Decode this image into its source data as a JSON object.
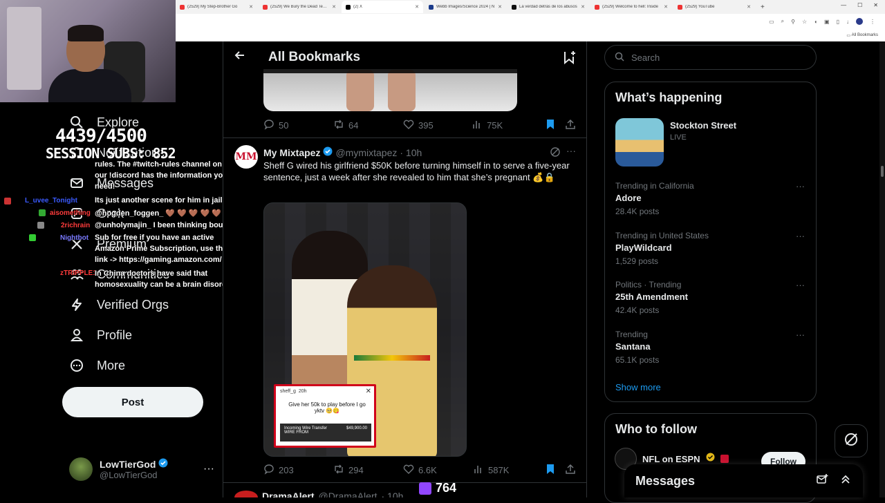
{
  "browser": {
    "tabs": [
      {
        "label": "(2529) My Step-Brother Go",
        "color": "#e33"
      },
      {
        "label": "(2529) We Bury the Dead Teaser",
        "color": "#e33"
      },
      {
        "label": "(2) X",
        "color": "#000"
      },
      {
        "label": "Webb Images/Science 2024 | N",
        "color": "#1a3a8a"
      },
      {
        "label": "La verdad detrás de los abusos",
        "color": "#111"
      },
      {
        "label": "(2529) Welcome to hell: Inside",
        "color": "#e33"
      },
      {
        "label": "(2529) YouTube",
        "color": "#e33"
      }
    ],
    "new_tab": "+",
    "all_bookmarks": "All Bookmarks"
  },
  "overlay": {
    "sub_goal": "4439/4500",
    "session_subs": "SESSION SUBS: 852"
  },
  "nav": {
    "explore": "Explore",
    "notifications": "Notifications",
    "messages": "Messages",
    "grok": "Grok",
    "premium": "Premium",
    "communities": "Communities",
    "verified_orgs": "Verified Orgs",
    "profile": "Profile",
    "more": "More",
    "post": "Post"
  },
  "account": {
    "name": "LowTierGod",
    "handle": "@LowTierGod",
    "more": "···"
  },
  "chat": {
    "lines": [
      {
        "text": "rules. The #twitch-rules channel on"
      },
      {
        "text": "our !discord has the information you"
      },
      {
        "text": "need!"
      },
      {
        "text": "Its just another scene for him in jail"
      },
      {
        "text": "@hogden_foggen_ 🤎 🤎 🤎 🤎 🤎"
      },
      {
        "text": "@unholymajin_ I been thinking bout it"
      },
      {
        "text": "Sub for free if you have an active"
      },
      {
        "text": "Amazon Prime Subscription, use this"
      },
      {
        "text": "link -> https://gaming.amazon.com/"
      },
      {
        "text": "In China doctors have said that"
      },
      {
        "text": "homosexuality can be a brain disorder"
      }
    ],
    "users": [
      {
        "name": "L_uvee_Tonight",
        "color": "#3b5bff"
      },
      {
        "name": "aisomething",
        "color": "#ff3b3b"
      },
      {
        "name": "2richrain",
        "color": "#ff3b3b"
      },
      {
        "name": "Nightbot",
        "color": "#7a7aff"
      },
      {
        "name": "zTRIPPLE1",
        "color": "#ff3b3b"
      }
    ]
  },
  "main": {
    "header_title": "All Bookmarks",
    "top_tweet_stats": {
      "replies": "50",
      "retweets": "64",
      "likes": "395",
      "views": "75K"
    },
    "tweet": {
      "name": "My Mixtapez",
      "handle": "@mymixtapez",
      "time": "· 10h",
      "avatar_text": "MM",
      "text": "Sheff G wired his girlfriend $50K before turning himself in to serve a five-year sentence, just a week after she revealed to him that she’s pregnant 💰🔒",
      "inset": {
        "user": "sheff_g",
        "time": "20h",
        "caption": "Give her 50k to play before I go yktv 🥺😋",
        "wire_label": "Incoming Wire Transfer",
        "wire_from": "WIRE FROM",
        "wire_amount": "$49,900.00",
        "close": "✕"
      },
      "stats": {
        "replies": "203",
        "retweets": "294",
        "likes": "6.6K",
        "views": "587K"
      }
    },
    "next_tweet": {
      "name": "DramaAlert",
      "handle": "@DramaAlert",
      "time": "· 10h"
    },
    "live_viewers": "764"
  },
  "right": {
    "search_placeholder": "Search",
    "happening_title": "What’s happening",
    "event": {
      "name": "Stockton Street",
      "status": "LIVE"
    },
    "trends": [
      {
        "category": "Trending in California",
        "name": "Adore",
        "count": "28.4K posts"
      },
      {
        "category": "Trending in United States",
        "name": "PlayWildcard",
        "count": "1,529 posts"
      },
      {
        "category": "Politics · Trending",
        "name": "25th Amendment",
        "count": "42.4K posts"
      },
      {
        "category": "Trending",
        "name": "Santana",
        "count": "65.1K posts"
      }
    ],
    "trend_more": "···",
    "show_more": "Show more",
    "follow_title": "Who to follow",
    "follow": {
      "name": "NFL on ESPN",
      "button": "Follow"
    },
    "messages_title": "Messages"
  },
  "colors": {
    "accent": "#1d9bf0",
    "bookmark": "#1d9bf0",
    "bg": "#000000"
  }
}
